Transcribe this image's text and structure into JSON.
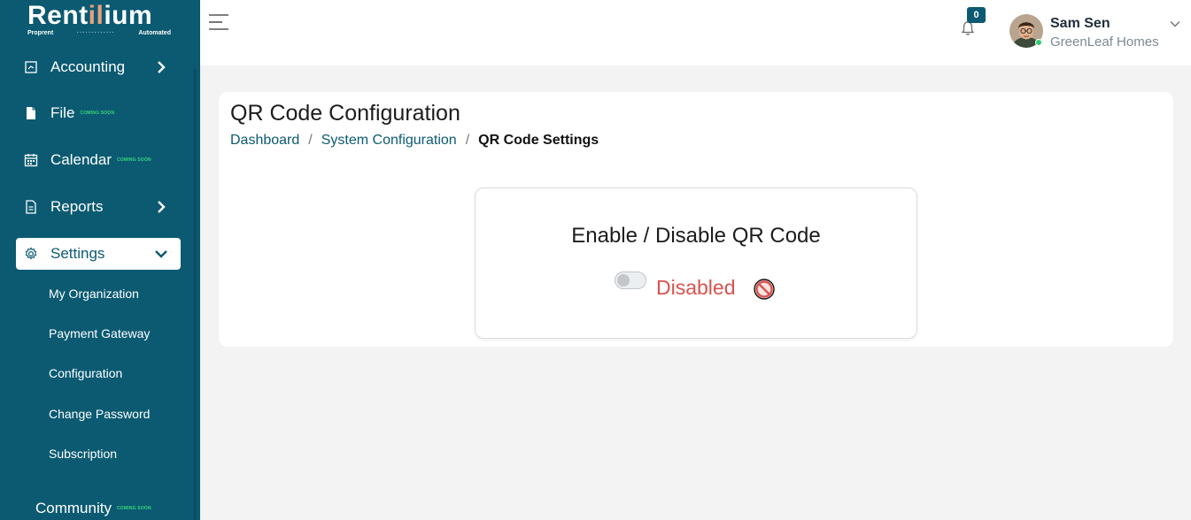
{
  "brand": {
    "name_prefix": "Rent",
    "name_accent": "il",
    "name_suffix": "ium",
    "tagline_left": "Proprent",
    "tagline_dots": "·············",
    "tagline_right": "Automated"
  },
  "sidebar": {
    "items": [
      {
        "label": "Accounting",
        "icon": "accounting-icon",
        "has_chevron": true
      },
      {
        "label": "File",
        "icon": "file-icon",
        "badge": "COMING SOON"
      },
      {
        "label": "Calendar",
        "icon": "calendar-icon",
        "badge": "COMING SOON"
      },
      {
        "label": "Reports",
        "icon": "reports-icon",
        "has_chevron": true
      },
      {
        "label": "Settings",
        "icon": "gear-icon",
        "active": true,
        "expanded": true
      }
    ],
    "settings_sub": [
      "My Organization",
      "Payment Gateway",
      "Configuration",
      "Change Password",
      "Subscription"
    ],
    "community": {
      "label": "Community",
      "badge": "COMING SOON"
    }
  },
  "header": {
    "notifications_count": "0",
    "user_name": "Sam Sen",
    "user_org": "GreenLeaf Homes"
  },
  "page": {
    "title": "QR Code Configuration",
    "breadcrumb": [
      "Dashboard",
      "System Configuration",
      "QR Code Settings"
    ],
    "qr_card": {
      "title": "Enable / Disable QR Code",
      "toggle_state": "off",
      "status_label": "Disabled"
    }
  },
  "colors": {
    "primary": "#0b5a72",
    "accent": "#e9a07b",
    "danger": "#d9534f",
    "coming_soon": "#39d67a"
  }
}
